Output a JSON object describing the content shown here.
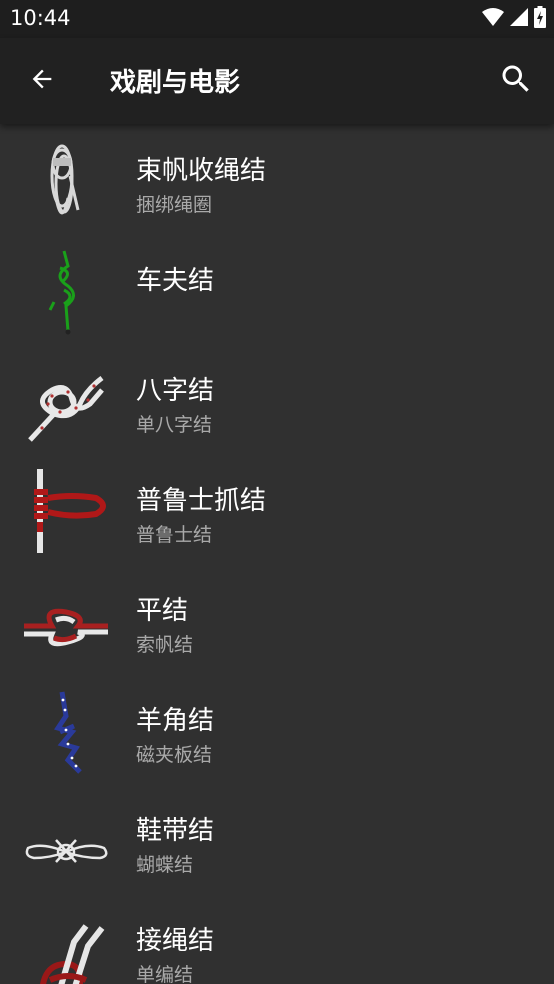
{
  "status": {
    "time": "10:44"
  },
  "appbar": {
    "title": "戏剧与电影"
  },
  "knots": [
    {
      "name": "束帆收绳结",
      "alias": "捆绑绳圈",
      "icon": "coil-rope-icon"
    },
    {
      "name": "车夫结",
      "alias": "",
      "icon": "green-knot-icon"
    },
    {
      "name": "八字结",
      "alias": "单八字结",
      "icon": "figure-eight-knot-icon"
    },
    {
      "name": "普鲁士抓结",
      "alias": "普鲁士结",
      "icon": "prusik-knot-icon"
    },
    {
      "name": "平结",
      "alias": "索帆结",
      "icon": "reef-knot-icon"
    },
    {
      "name": "羊角结",
      "alias": "磁夹板结",
      "icon": "cleat-hitch-icon"
    },
    {
      "name": "鞋带结",
      "alias": "蝴蝶结",
      "icon": "bow-knot-icon"
    },
    {
      "name": "接绳结",
      "alias": "单编结",
      "icon": "sheet-bend-icon"
    }
  ]
}
